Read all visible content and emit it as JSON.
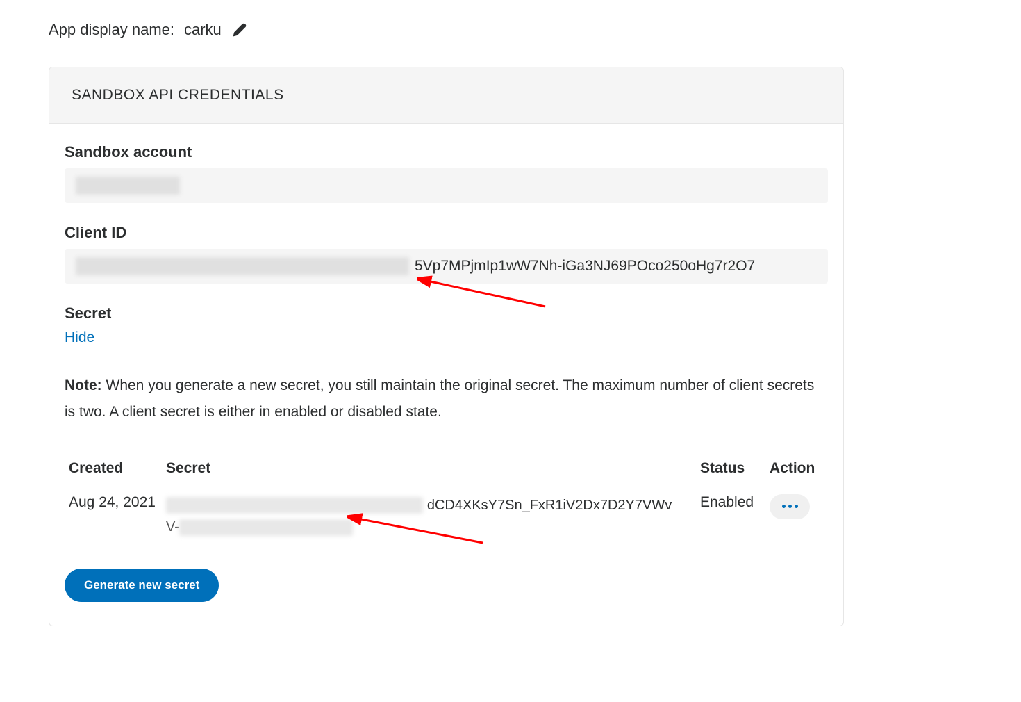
{
  "header": {
    "app_display_name_label": "App display name:",
    "app_display_name_value": "carku"
  },
  "card": {
    "header_title": "SANDBOX API CREDENTIALS",
    "sandbox_account_label": "Sandbox account",
    "client_id_label": "Client ID",
    "client_id_visible_part": "5Vp7MPjmIp1wW7Nh-iGa3NJ69POco250oHg7r2O7",
    "secret_label": "Secret",
    "secret_toggle": "Hide",
    "note_label": "Note:",
    "note_text": " When you generate a new secret, you still maintain the original secret. The maximum number of client secrets is two. A client secret is either in enabled or disabled state.",
    "generate_button": "Generate new secret"
  },
  "secrets_table": {
    "headers": {
      "created": "Created",
      "secret": "Secret",
      "status": "Status",
      "action": "Action"
    },
    "rows": [
      {
        "created": "Aug 24, 2021",
        "secret_visible_top": "dCD4XKsY7Sn_FxR1iV2Dx7D2Y7VWv",
        "secret_visible_bottom_prefix": "V-",
        "status": "Enabled"
      }
    ]
  }
}
